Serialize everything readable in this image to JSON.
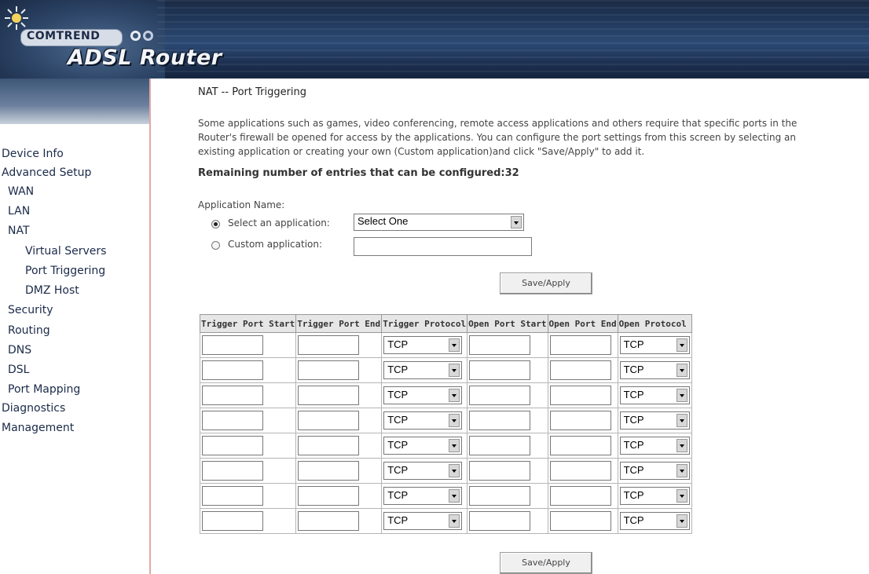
{
  "header": {
    "brand": "COMTREND",
    "product": "ADSL Router"
  },
  "nav": [
    {
      "label": "Device Info",
      "level": 0
    },
    {
      "label": "Advanced Setup",
      "level": 0
    },
    {
      "label": "WAN",
      "level": 1
    },
    {
      "label": "LAN",
      "level": 1
    },
    {
      "label": "NAT",
      "level": 1
    },
    {
      "label": "Virtual Servers",
      "level": 2
    },
    {
      "label": "Port Triggering",
      "level": 2
    },
    {
      "label": "DMZ Host",
      "level": 2
    },
    {
      "label": "Security",
      "level": 1
    },
    {
      "label": "Routing",
      "level": 1
    },
    {
      "label": "DNS",
      "level": 1
    },
    {
      "label": "DSL",
      "level": 1
    },
    {
      "label": "Port Mapping",
      "level": 1
    },
    {
      "label": "Diagnostics",
      "level": 0
    },
    {
      "label": "Management",
      "level": 0
    }
  ],
  "main": {
    "title": "NAT -- Port Triggering",
    "description_lines": [
      "Some applications such as games, video conferencing, remote access applications and others require that specific ports in the",
      "Router's firewall be opened for access by the applications. You can configure the port settings from this screen by selecting an",
      "existing application or creating your own (Custom application)and click \"Save/Apply\" to add it."
    ],
    "remaining": "Remaining number of entries that can be configured:32",
    "app_name_label": "Application Name:",
    "select_app_label": "Select an application:",
    "select_app_value": "Select One",
    "custom_app_label": "Custom application:",
    "custom_app_value": "",
    "selected_option": "select",
    "save_label": "Save/Apply"
  },
  "table": {
    "headers": [
      "Trigger Port Start",
      "Trigger Port End",
      "Trigger Protocol",
      "Open Port Start",
      "Open Port End",
      "Open Protocol"
    ],
    "rows": [
      {
        "trigger_start": "",
        "trigger_end": "",
        "trigger_protocol": "TCP",
        "open_start": "",
        "open_end": "",
        "open_protocol": "TCP"
      },
      {
        "trigger_start": "",
        "trigger_end": "",
        "trigger_protocol": "TCP",
        "open_start": "",
        "open_end": "",
        "open_protocol": "TCP"
      },
      {
        "trigger_start": "",
        "trigger_end": "",
        "trigger_protocol": "TCP",
        "open_start": "",
        "open_end": "",
        "open_protocol": "TCP"
      },
      {
        "trigger_start": "",
        "trigger_end": "",
        "trigger_protocol": "TCP",
        "open_start": "",
        "open_end": "",
        "open_protocol": "TCP"
      },
      {
        "trigger_start": "",
        "trigger_end": "",
        "trigger_protocol": "TCP",
        "open_start": "",
        "open_end": "",
        "open_protocol": "TCP"
      },
      {
        "trigger_start": "",
        "trigger_end": "",
        "trigger_protocol": "TCP",
        "open_start": "",
        "open_end": "",
        "open_protocol": "TCP"
      },
      {
        "trigger_start": "",
        "trigger_end": "",
        "trigger_protocol": "TCP",
        "open_start": "",
        "open_end": "",
        "open_protocol": "TCP"
      },
      {
        "trigger_start": "",
        "trigger_end": "",
        "trigger_protocol": "TCP",
        "open_start": "",
        "open_end": "",
        "open_protocol": "TCP"
      }
    ]
  }
}
